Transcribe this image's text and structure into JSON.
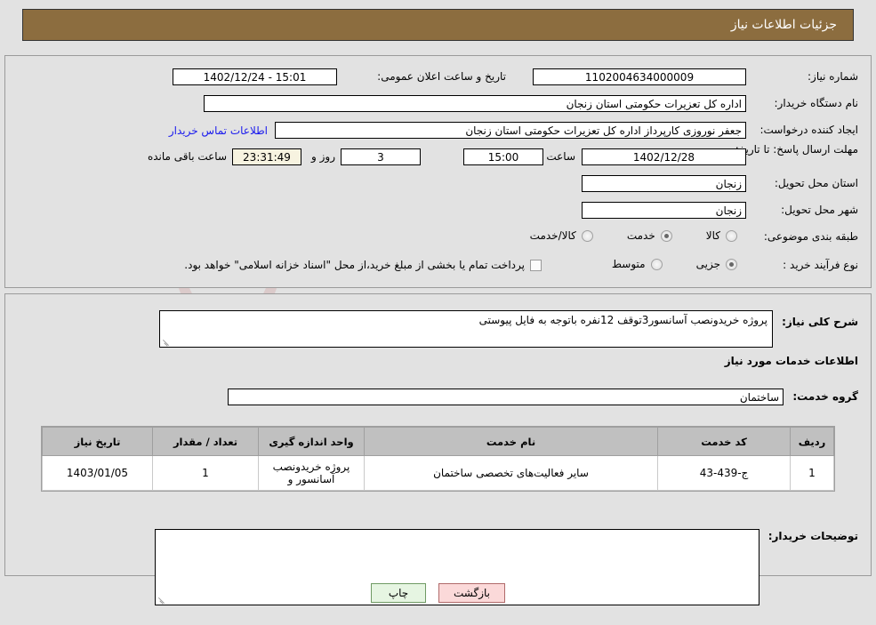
{
  "header": {
    "title": "جزئیات اطلاعات نیاز"
  },
  "top_form": {
    "need_number_label": "شماره نیاز:",
    "need_number_value": "1102004634000009",
    "announce_datetime_label": "تاریخ و ساعت اعلان عمومی:",
    "announce_datetime_value": "15:01 - 1402/12/24",
    "buyer_org_label": "نام دستگاه خریدار:",
    "buyer_org_value": "اداره کل تعزیرات حکومتی استان زنجان",
    "creator_label": "ایجاد کننده درخواست:",
    "creator_value": "جعفر نوروزی کارپرداز اداره کل تعزیرات حکومتی استان زنجان",
    "buyer_contact_link": "اطلاعات تماس خریدار",
    "deadline_label": "مهلت ارسال پاسخ: تا تاریخ:",
    "deadline_date": "1402/12/28",
    "deadline_hour_label": "ساعت",
    "deadline_time": "15:00",
    "remaining_days": "3",
    "remaining_days_suffix": "روز و",
    "remaining_clock": "23:31:49",
    "remaining_suffix": "ساعت باقی مانده",
    "province_label": "استان محل تحویل:",
    "province_value": "زنجان",
    "city_label": "شهر محل تحویل:",
    "city_value": "زنجان",
    "classification_label": "طبقه بندی موضوعی:",
    "classification_options": [
      {
        "label": "کالا",
        "selected": false
      },
      {
        "label": "خدمت",
        "selected": true
      },
      {
        "label": "کالا/خدمت",
        "selected": false
      }
    ],
    "process_type_label": "نوع فرآیند خرید :",
    "process_type_options": [
      {
        "label": "جزیی",
        "selected": true
      },
      {
        "label": "متوسط",
        "selected": false
      }
    ],
    "treasury_checkbox_label": "پرداخت تمام یا بخشی از مبلغ خرید،از محل \"اسناد خزانه اسلامی\" خواهد بود.",
    "treasury_checked": false
  },
  "bottom_form": {
    "general_desc_label": "شرح کلی نیاز:",
    "general_desc_value": "پروژه خریدونصب آسانسور3توقف 12نفره باتوجه به فایل پیوستی",
    "services_section_title": "اطلاعات خدمات مورد نیاز",
    "service_group_label": "گروه خدمت:",
    "service_group_value": "ساختمان",
    "buyer_notes_label": "توضیحات خریدار:",
    "buyer_notes_value": ""
  },
  "table": {
    "columns": [
      "ردیف",
      "کد خدمت",
      "نام خدمت",
      "واحد اندازه گیری",
      "تعداد / مقدار",
      "تاریخ نیاز"
    ],
    "rows": [
      {
        "index": "1",
        "service_code": "ج-439-43",
        "service_name": "سایر فعالیت‌های تخصصی ساختمان",
        "unit": "پروژه خریدونصب آسانسور و",
        "quantity": "1",
        "need_date": "1403/01/05"
      }
    ]
  },
  "buttons": {
    "print": "چاپ",
    "back": "بازگشت"
  },
  "watermark": {
    "text": "AnaTender.net"
  },
  "colors": {
    "header_brown": "#8c6d3f",
    "page_bg": "#e2e2e2",
    "link_blue": "#1a1aee",
    "table_header": "#c0c0c0",
    "btn_print_bg": "#e6f5e2",
    "btn_back_bg": "#fbd9d9"
  }
}
